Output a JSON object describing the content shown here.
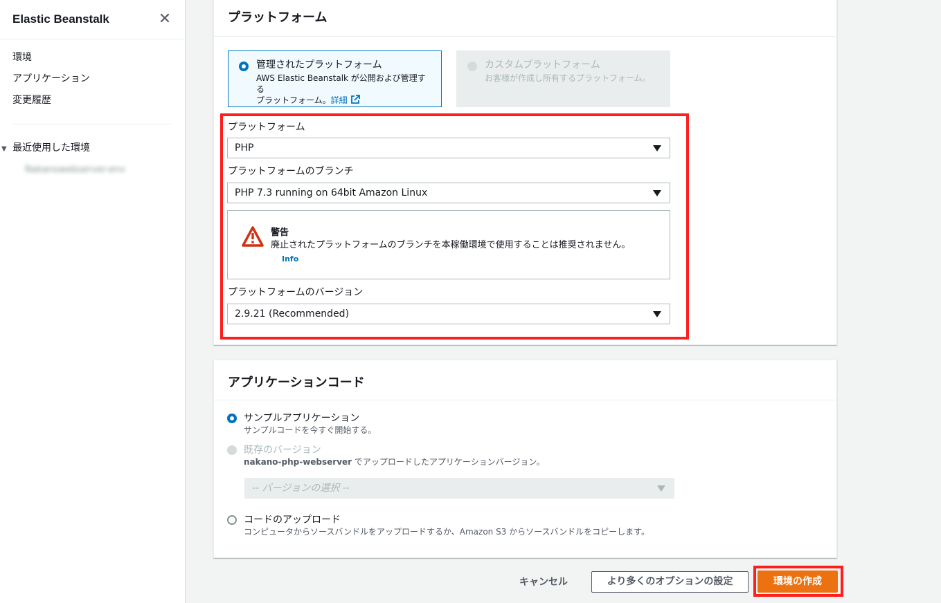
{
  "sidebar": {
    "title": "Elastic Beanstalk",
    "close_glyph": "✕",
    "nav": [
      {
        "label": "環境"
      },
      {
        "label": "アプリケーション"
      },
      {
        "label": "変更履歴"
      }
    ],
    "recent_label": "最近使用した環境",
    "recent_env": "Nakanowebserver-env"
  },
  "platform_panel": {
    "title": "プラットフォーム",
    "managed_tile": {
      "label": "管理されたプラットフォーム",
      "desc_line1": "AWS Elastic Beanstalk が公開および管理する",
      "desc_line2": "プラットフォーム。",
      "link": "詳細"
    },
    "custom_tile": {
      "label": "カスタムプラットフォーム",
      "desc": "お客様が作成し所有するプラットフォーム。"
    },
    "platform_label": "プラットフォーム",
    "platform_value": "PHP",
    "branch_label": "プラットフォームのブランチ",
    "branch_value": "PHP 7.3 running on 64bit Amazon Linux",
    "warning": {
      "title": "警告",
      "body": "廃止されたプラットフォームのブランチを本稼働環境で使用することは推奨されません。",
      "info": "Info"
    },
    "version_label": "プラットフォームのバージョン",
    "version_value": "2.9.21 (Recommended)"
  },
  "app_code_panel": {
    "title": "アプリケーションコード",
    "sample": {
      "label": "サンプルアプリケーション",
      "desc": "サンプルコードを今すぐ開始する。"
    },
    "existing": {
      "label": "既存のバージョン",
      "desc_bold": "nakano-php-webserver",
      "desc_rest": " でアップロードしたアプリケーションバージョン。",
      "select_placeholder": "-- バージョンの選択 --"
    },
    "upload": {
      "label": "コードのアップロード",
      "desc": "コンピュータからソースバンドルをアップロードするか、Amazon S3 からソースバンドルをコピーします。"
    }
  },
  "footer": {
    "cancel": "キャンセル",
    "more_options": "より多くのオプションの設定",
    "create": "環境の作成"
  },
  "colors": {
    "accent": "#0073bb",
    "primary_button": "#ec7211",
    "highlight": "#ff1e1e",
    "warning_icon": "#d13212"
  }
}
